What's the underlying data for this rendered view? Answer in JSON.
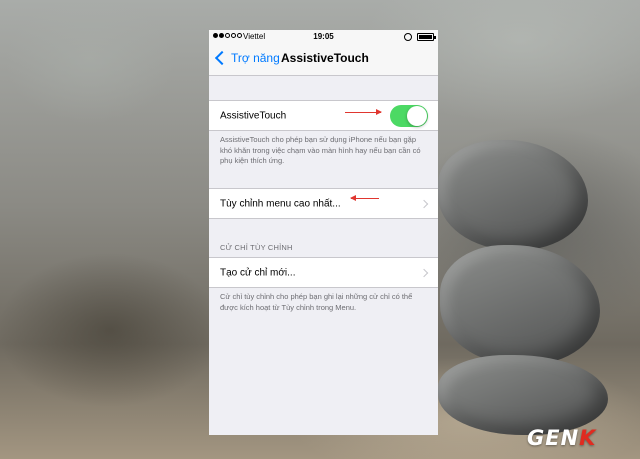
{
  "status_bar": {
    "carrier": "Viettel",
    "time": "19:05"
  },
  "nav": {
    "back_label": "Trợ năng",
    "title": "AssistiveTouch"
  },
  "assistivetouch": {
    "label": "AssistiveTouch",
    "toggle_on": true,
    "toggle_color": "#4cd964",
    "description": "AssistiveTouch cho phép bạn sử dụng iPhone nếu bạn gặp khó khăn trong việc chạm vào màn hình hay nếu bạn cần có phụ kiện thích ứng."
  },
  "customize_menu": {
    "label": "Tùy chỉnh menu cao nhất..."
  },
  "custom_gestures": {
    "header": "CỬ CHỈ TÙY CHỈNH",
    "create_label": "Tạo cử chỉ mới...",
    "description": "Cử chỉ tùy chỉnh cho phép bạn ghi lại những cử chỉ có thể được kích hoạt từ Tùy chỉnh trong Menu."
  },
  "annotation_color": "#e0362f",
  "accent_color": "#007aff",
  "watermark": {
    "text_main": "GEN",
    "text_accent": "K"
  }
}
